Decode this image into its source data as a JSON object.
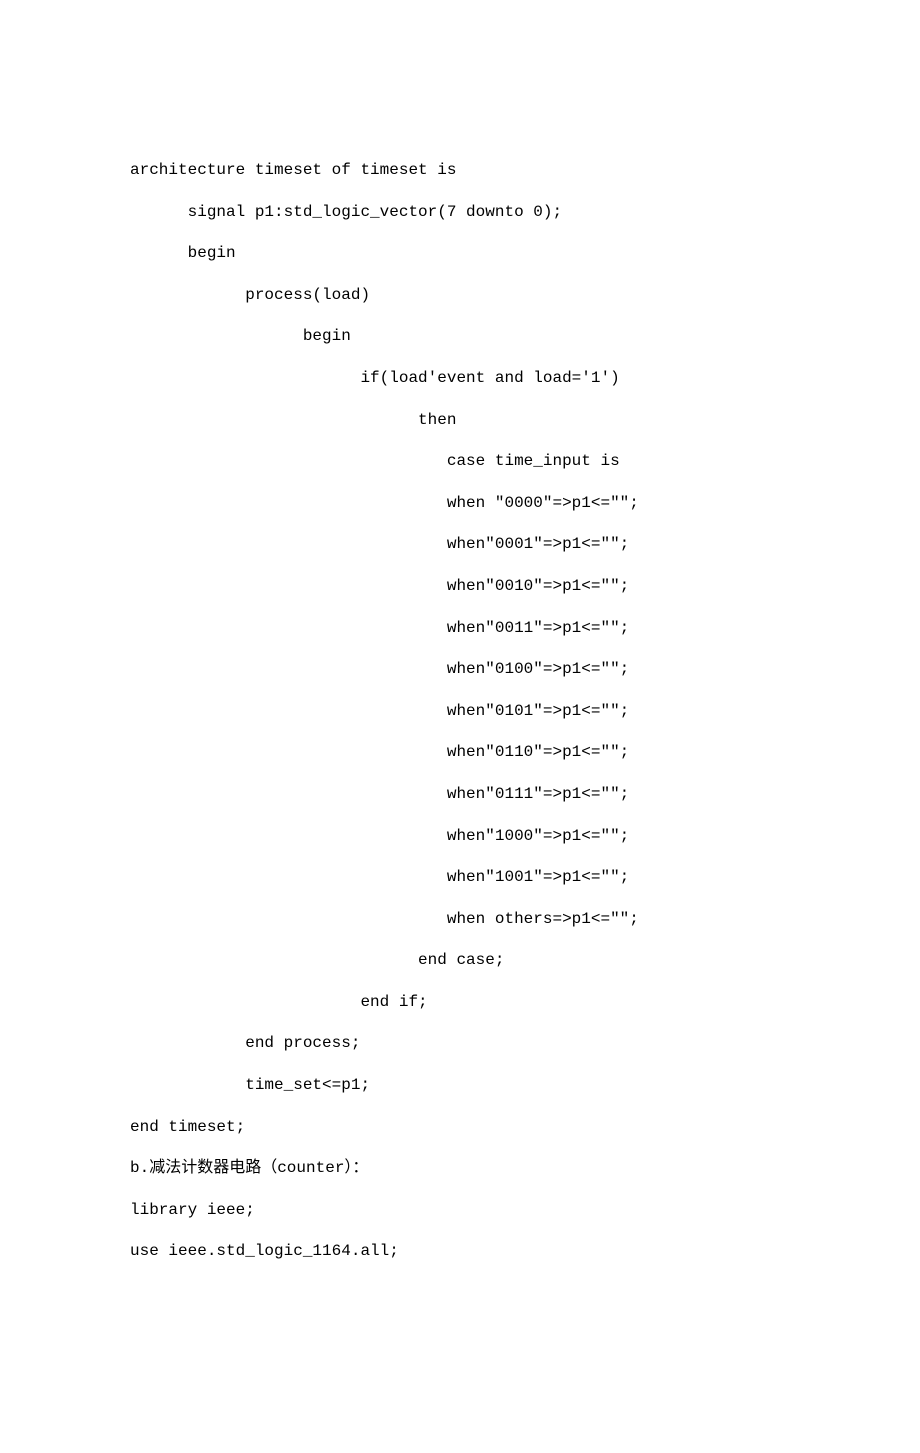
{
  "lines": [
    {
      "indent": 0,
      "text": "architecture timeset of timeset is"
    },
    {
      "indent": 0,
      "text": ""
    },
    {
      "indent": 1,
      "text": "signal p1:std_logic_vector(7 downto 0);"
    },
    {
      "indent": 1,
      "text": "begin"
    },
    {
      "indent": 2,
      "text": "process(load)"
    },
    {
      "indent": 3,
      "text": "begin"
    },
    {
      "indent": 4,
      "text": "if(load'event and load='1')"
    },
    {
      "indent": 5,
      "text": "then"
    },
    {
      "indent": 5.5,
      "text": "case time_input is"
    },
    {
      "indent": 5.5,
      "text": "when \"0000\"=>p1<=\"\";"
    },
    {
      "indent": 5.5,
      "text": "when\"0001\"=>p1<=\"\";"
    },
    {
      "indent": 5.5,
      "text": "when\"0010\"=>p1<=\"\";"
    },
    {
      "indent": 5.5,
      "text": "when\"0011\"=>p1<=\"\";"
    },
    {
      "indent": 5.5,
      "text": "when\"0100\"=>p1<=\"\";"
    },
    {
      "indent": 5.5,
      "text": "when\"0101\"=>p1<=\"\";"
    },
    {
      "indent": 5.5,
      "text": "when\"0110\"=>p1<=\"\";"
    },
    {
      "indent": 5.5,
      "text": "when\"0111\"=>p1<=\"\";"
    },
    {
      "indent": 5.5,
      "text": "when\"1000\"=>p1<=\"\";"
    },
    {
      "indent": 5.5,
      "text": "when\"1001\"=>p1<=\"\";"
    },
    {
      "indent": 5.5,
      "text": "when others=>p1<=\"\";"
    },
    {
      "indent": 5,
      "text": "end case;"
    },
    {
      "indent": 4,
      "text": "end if;"
    },
    {
      "indent": 2,
      "text": "end process;"
    },
    {
      "indent": 2,
      "text": "time_set<=p1;"
    },
    {
      "indent": 0,
      "text": "end timeset;"
    },
    {
      "indent": 0,
      "text": "b.减法计数器电路（counter）："
    },
    {
      "indent": 0,
      "text": "library ieee;"
    },
    {
      "indent": 0,
      "text": "use ieee.std_logic_1164.all;"
    }
  ],
  "indent_unit": "      "
}
